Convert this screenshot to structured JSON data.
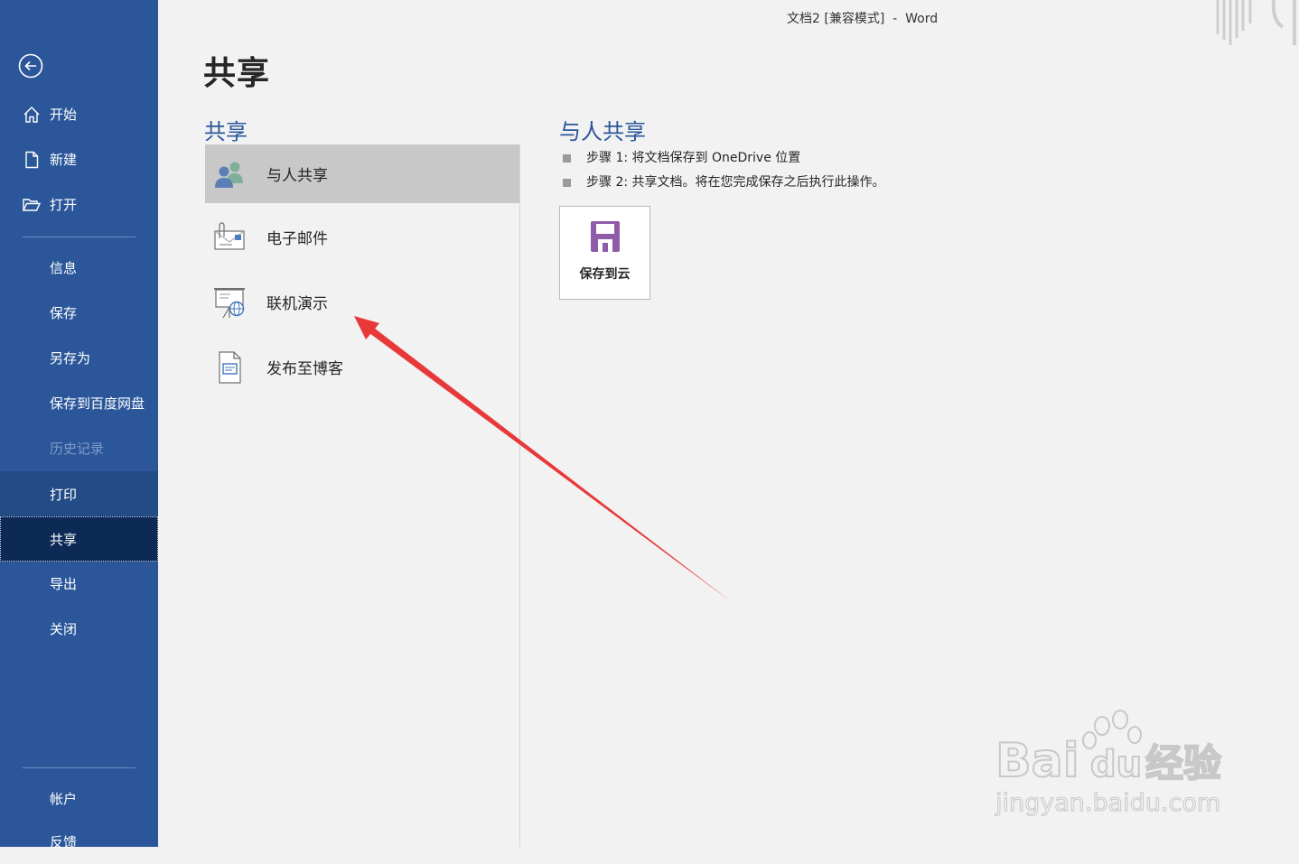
{
  "window": {
    "title": "文档2 [兼容模式]  -  Word"
  },
  "sidebar": {
    "items": [
      {
        "label": "开始",
        "icon": "home-icon"
      },
      {
        "label": "新建",
        "icon": "new-document-icon"
      },
      {
        "label": "打开",
        "icon": "folder-open-icon"
      },
      {
        "label": "信息"
      },
      {
        "label": "保存"
      },
      {
        "label": "另存为"
      },
      {
        "label": "保存到百度网盘"
      },
      {
        "label": "历史记录",
        "state": "disabled"
      },
      {
        "label": "打印"
      },
      {
        "label": "共享",
        "state": "selected"
      },
      {
        "label": "导出"
      },
      {
        "label": "关闭"
      },
      {
        "label": "帐户"
      },
      {
        "label": "反馈"
      }
    ]
  },
  "page": {
    "title": "共享",
    "share_heading": "共享",
    "share_items": [
      {
        "label": "与人共享",
        "icon": "people-icon",
        "selected": true
      },
      {
        "label": "电子邮件",
        "icon": "email-icon"
      },
      {
        "label": "联机演示",
        "icon": "online-presentation-icon"
      },
      {
        "label": "发布至博客",
        "icon": "blog-icon"
      }
    ],
    "detail": {
      "heading": "与人共享",
      "steps": [
        "步骤 1: 将文档保存到 OneDrive 位置",
        "步骤 2: 共享文档。将在您完成保存之后执行此操作。"
      ],
      "save_cloud_label": "保存到云"
    }
  },
  "watermark": {
    "brand": "Bai",
    "brand_du": "du",
    "suffix": "经验",
    "url": "jingyan.baidu.com"
  },
  "colors": {
    "sidebar": "#2b579a",
    "accent": "#2b579a",
    "annotation_arrow": "#e8393a",
    "save_icon": "#8e5ca8"
  }
}
